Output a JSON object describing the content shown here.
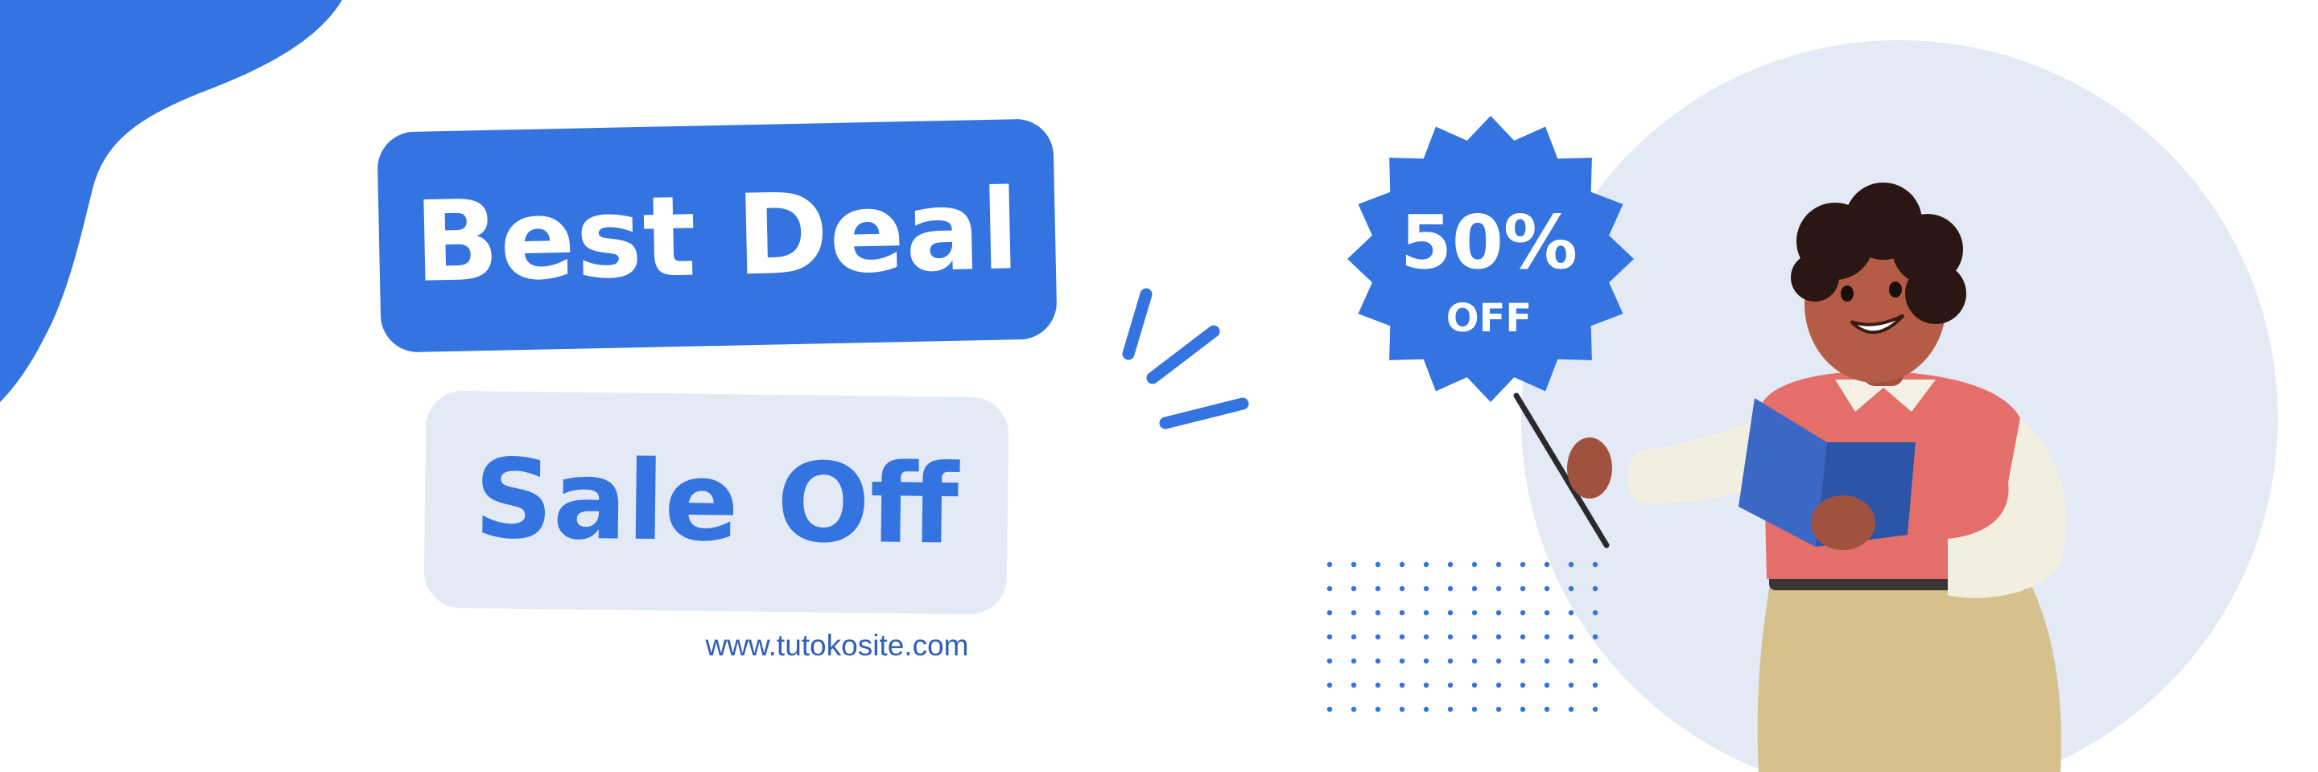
{
  "banner": {
    "headline": "Best Deal",
    "subheadline": "Sale Off",
    "website": "www.tutokosite.com",
    "badge": {
      "percent": "50%",
      "label": "OFF"
    }
  },
  "colors": {
    "primary_blue": "#3474e0",
    "light_blue_gray": "#e4e9f6",
    "website_text": "#2f5fb8",
    "background": "#ffffff"
  },
  "icons": [
    "corner-blob-shape",
    "burst-lines-icon",
    "dot-grid-pattern",
    "starburst-badge",
    "teacher-illustration"
  ]
}
